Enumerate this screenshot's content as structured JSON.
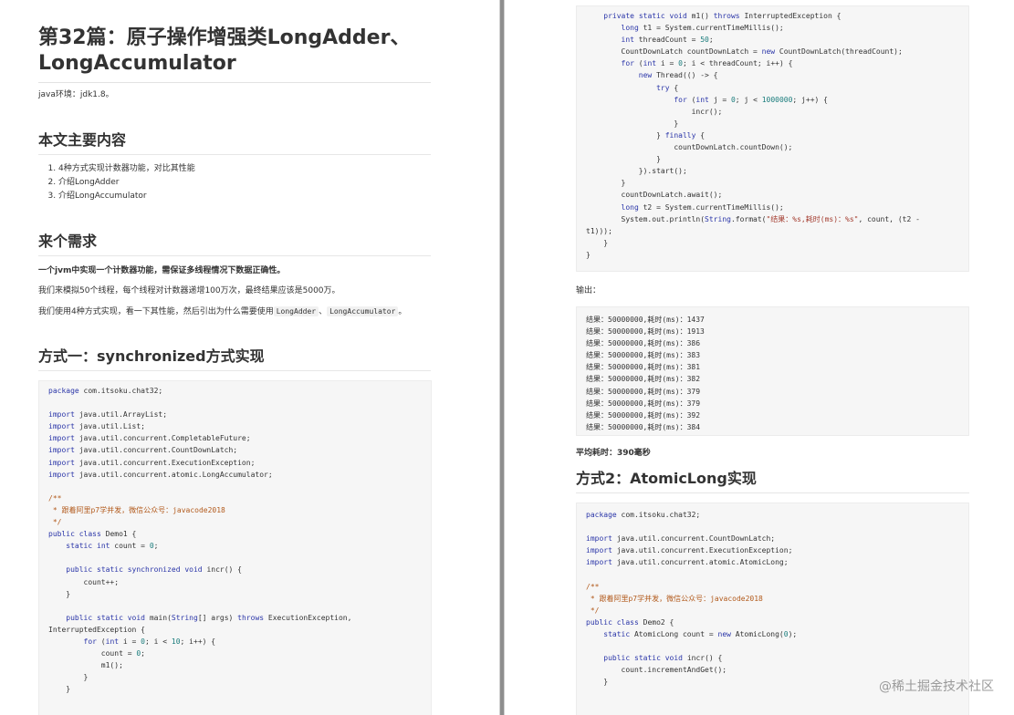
{
  "left": {
    "title": "第32篇：原子操作增强类LongAdder、LongAccumulator",
    "env_text": "java环境：jdk1.8。",
    "section1_heading": "本文主要内容",
    "toc": [
      "4种方式实现计数器功能，对比其性能",
      "介绍LongAdder",
      "介绍LongAccumulator"
    ],
    "section2_heading": "来个需求",
    "req_bold": "一个jvm中实现一个计数器功能，需保证多线程情况下数据正确性。",
    "req_para1": "我们来模拟50个线程，每个线程对计数器递增100万次，最终结果应该是5000万。",
    "req_para2_prefix": "我们使用4种方式实现，看一下其性能，然后引出为什么需要使用",
    "req_para2_code1": "LongAdder",
    "req_para2_sep": "、",
    "req_para2_code2": "LongAccumulator",
    "req_para2_suffix": "。",
    "section3_heading": "方式一：synchronized方式实现",
    "code_lines": [
      "package com.itsoku.chat32;",
      "",
      "import java.util.ArrayList;",
      "import java.util.List;",
      "import java.util.concurrent.CompletableFuture;",
      "import java.util.concurrent.CountDownLatch;",
      "import java.util.concurrent.ExecutionException;",
      "import java.util.concurrent.atomic.LongAccumulator;",
      "",
      "/**",
      " * 跟着阿里p7学并发，微信公众号：javacode2018",
      " */",
      "public class Demo1 {",
      "    static int count = 0;",
      "",
      "    public static synchronized void incr() {",
      "        count++;",
      "    }",
      "",
      "    public static void main(String[] args) throws ExecutionException,",
      "InterruptedException {",
      "        for (int i = 0; i < 10; i++) {",
      "            count = 0;",
      "            m1();",
      "        }",
      "    }"
    ]
  },
  "right": {
    "code_lines_1": [
      "    private static void m1() throws InterruptedException {",
      "        long t1 = System.currentTimeMillis();",
      "        int threadCount = 50;",
      "        CountDownLatch countDownLatch = new CountDownLatch(threadCount);",
      "        for (int i = 0; i < threadCount; i++) {",
      "            new Thread(() -> {",
      "                try {",
      "                    for (int j = 0; j < 1000000; j++) {",
      "                        incr();",
      "                    }",
      "                } finally {",
      "                    countDownLatch.countDown();",
      "                }",
      "            }).start();",
      "        }",
      "        countDownLatch.await();",
      "        long t2 = System.currentTimeMillis();",
      "        System.out.println(String.format(\"结果：%s,耗时(ms)：%s\", count, (t2 -",
      "t1)));",
      "    }",
      "}"
    ],
    "output_label": "输出：",
    "output_lines": [
      "结果：50000000,耗时(ms)：1437",
      "结果：50000000,耗时(ms)：1913",
      "结果：50000000,耗时(ms)：386",
      "结果：50000000,耗时(ms)：383",
      "结果：50000000,耗时(ms)：381",
      "结果：50000000,耗时(ms)：382",
      "结果：50000000,耗时(ms)：379",
      "结果：50000000,耗时(ms)：379",
      "结果：50000000,耗时(ms)：392",
      "结果：50000000,耗时(ms)：384"
    ],
    "avg_text": "平均耗时：390毫秒",
    "section4_heading": "方式2：AtomicLong实现",
    "code_lines_2": [
      "package com.itsoku.chat32;",
      "",
      "import java.util.concurrent.CountDownLatch;",
      "import java.util.concurrent.ExecutionException;",
      "import java.util.concurrent.atomic.AtomicLong;",
      "",
      "/**",
      " * 跟着阿里p7学并发，微信公众号：javacode2018",
      " */",
      "public class Demo2 {",
      "    static AtomicLong count = new AtomicLong(0);",
      "",
      "    public static void incr() {",
      "        count.incrementAndGet();",
      "    }"
    ]
  },
  "watermark": "@稀土掘金技术社区"
}
